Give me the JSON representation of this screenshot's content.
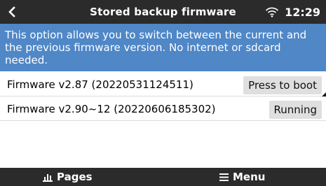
{
  "header": {
    "title": "Stored backup firmware",
    "time": "12:29",
    "back_icon": "chevron-left-icon",
    "wifi_icon": "wifi-icon"
  },
  "info": {
    "text": "This option allows you to switch between the current and the previous firmware version. No internet or sdcard needed."
  },
  "firmware_list": [
    {
      "label": "Firmware v2.87 (20220531124511)",
      "action": "Press to boot",
      "selected": true
    },
    {
      "label": "Firmware v2.90~12 (20220606185302)",
      "action": "Running",
      "selected": false
    }
  ],
  "footer": {
    "pages_label": "Pages",
    "pages_icon": "bar-chart-icon",
    "menu_label": "Menu",
    "menu_icon": "hamburger-menu-icon"
  },
  "colors": {
    "header_bg": "#2b2b2b",
    "info_bg": "#4f87c7",
    "button_bg": "#dfdfdf"
  }
}
